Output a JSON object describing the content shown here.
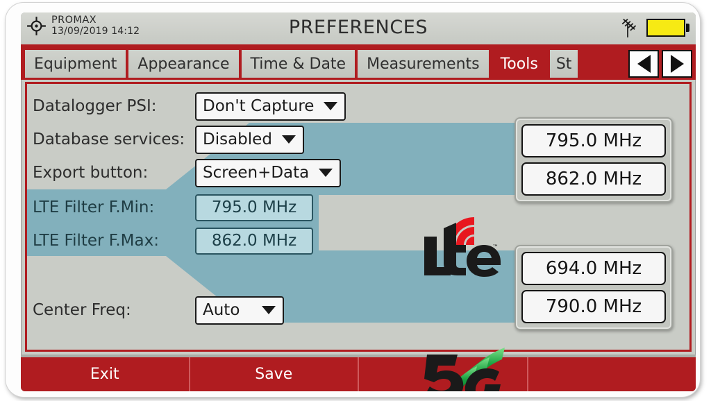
{
  "header": {
    "brand": "PROMAX",
    "datetime": "13/09/2019 14:12",
    "title": "PREFERENCES",
    "crosshair_icon": "crosshair-icon",
    "antenna_icon": "antenna-icon",
    "battery_icon": "battery-full-icon",
    "battery_color": "#f6ea14",
    "accent_color": "#b01c20"
  },
  "tabs": [
    {
      "label": "Equipment",
      "active": false
    },
    {
      "label": "Appearance",
      "active": false
    },
    {
      "label": "Time & Date",
      "active": false
    },
    {
      "label": "Measurements",
      "active": false
    },
    {
      "label": "Tools",
      "active": true
    },
    {
      "label": "St",
      "active": false
    }
  ],
  "tab_nav": {
    "prev_icon": "arrow-left-icon",
    "next_icon": "arrow-right-icon"
  },
  "form": {
    "rows": [
      {
        "label": "Datalogger PSI:",
        "value": "Don't Capture",
        "type": "dropdown"
      },
      {
        "label": "Database services:",
        "value": "Disabled",
        "type": "dropdown"
      },
      {
        "label": "Export button:",
        "value": "Screen+Data",
        "type": "dropdown"
      },
      {
        "label": "LTE Filter F.Min:",
        "value": "795.0 MHz",
        "type": "value",
        "highlighted": true
      },
      {
        "label": "LTE Filter F.Max:",
        "value": "862.0 MHz",
        "type": "value",
        "highlighted": true
      },
      {
        "label": "Center Freq:",
        "value": "Auto",
        "type": "dropdown"
      }
    ]
  },
  "diagram": {
    "band_color": "#82b0bc",
    "lte": {
      "logo": "lte-logo",
      "wave_color": "#e8171f",
      "freq_min": "795.0 MHz",
      "freq_max": "862.0 MHz"
    },
    "g5": {
      "logo": "5g-logo",
      "wave_color": "#16a34a",
      "freq_min": "694.0 MHz",
      "freq_max": "790.0 MHz"
    }
  },
  "softkeys": [
    {
      "label": "Exit"
    },
    {
      "label": "Save"
    },
    {
      "label": ""
    },
    {
      "label": ""
    }
  ]
}
